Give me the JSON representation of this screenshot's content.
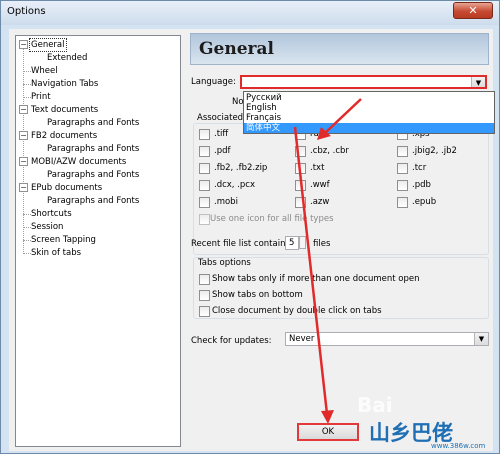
{
  "window": {
    "title": "Options",
    "close_glyph": "✕"
  },
  "tree": {
    "items": [
      {
        "label": "General",
        "level": 0,
        "selected": true,
        "expander": "−"
      },
      {
        "label": "Extended",
        "level": 1
      },
      {
        "label": "Wheel",
        "level": 0
      },
      {
        "label": "Navigation Tabs",
        "level": 0
      },
      {
        "label": "Print",
        "level": 0
      },
      {
        "label": "Text documents",
        "level": 0,
        "expander": "−"
      },
      {
        "label": "Paragraphs and Fonts",
        "level": 1
      },
      {
        "label": "FB2 documents",
        "level": 0,
        "expander": "−"
      },
      {
        "label": "Paragraphs and Fonts",
        "level": 1
      },
      {
        "label": "MOBI/AZW documents",
        "level": 0,
        "expander": "−"
      },
      {
        "label": "Paragraphs and Fonts",
        "level": 1
      },
      {
        "label": "EPub documents",
        "level": 0,
        "expander": "−"
      },
      {
        "label": "Paragraphs and Fonts",
        "level": 1
      },
      {
        "label": "Shortcuts",
        "level": 0
      },
      {
        "label": "Session",
        "level": 0
      },
      {
        "label": "Screen Tapping",
        "level": 0
      },
      {
        "label": "Skin of tabs",
        "level": 0
      }
    ]
  },
  "general": {
    "heading": "General",
    "language_label": "Language:",
    "language_value": "",
    "language_options": [
      "Русский",
      "English",
      "Français",
      "简体中文"
    ],
    "language_highlighted": "简体中文",
    "partial_no": "No",
    "assoc_label": "Associated"
  },
  "file_types": [
    [
      ".tiff",
      "",
      ".xps"
    ],
    [
      ".pdf",
      ".cbz, .cbr",
      ".jbig2, .jb2"
    ],
    [
      ".fb2, .fb2.zip",
      ".txt",
      ".tcr"
    ],
    [
      ".dcx, .pcx",
      ".wwf",
      ".pdb"
    ],
    [
      ".mobi",
      ".azw",
      ".epub"
    ]
  ],
  "file_types_partial": {
    "row0_col1": "rd"
  },
  "use_one_icon": "Use one icon for all file types",
  "recent": {
    "label": "Recent file list contains:",
    "value": "5",
    "suffix": "files"
  },
  "tabs_options": {
    "title": "Tabs options",
    "items": [
      "Show tabs only if more than one document open",
      "Show tabs on bottom",
      "Close document by double click on tabs"
    ]
  },
  "updates": {
    "label": "Check for updates:",
    "value": "Never"
  },
  "buttons": {
    "ok": "OK"
  },
  "watermark": {
    "brand": "Bai",
    "logo_text": "山乡巴佬",
    "url": "www.386w.com"
  },
  "colors": {
    "annotation_red": "#e12b2b",
    "highlight": "#3399ff"
  },
  "icons": [
    "expand-minus-icon",
    "dropdown-arrow-icon",
    "checkbox-icon",
    "close-icon"
  ]
}
